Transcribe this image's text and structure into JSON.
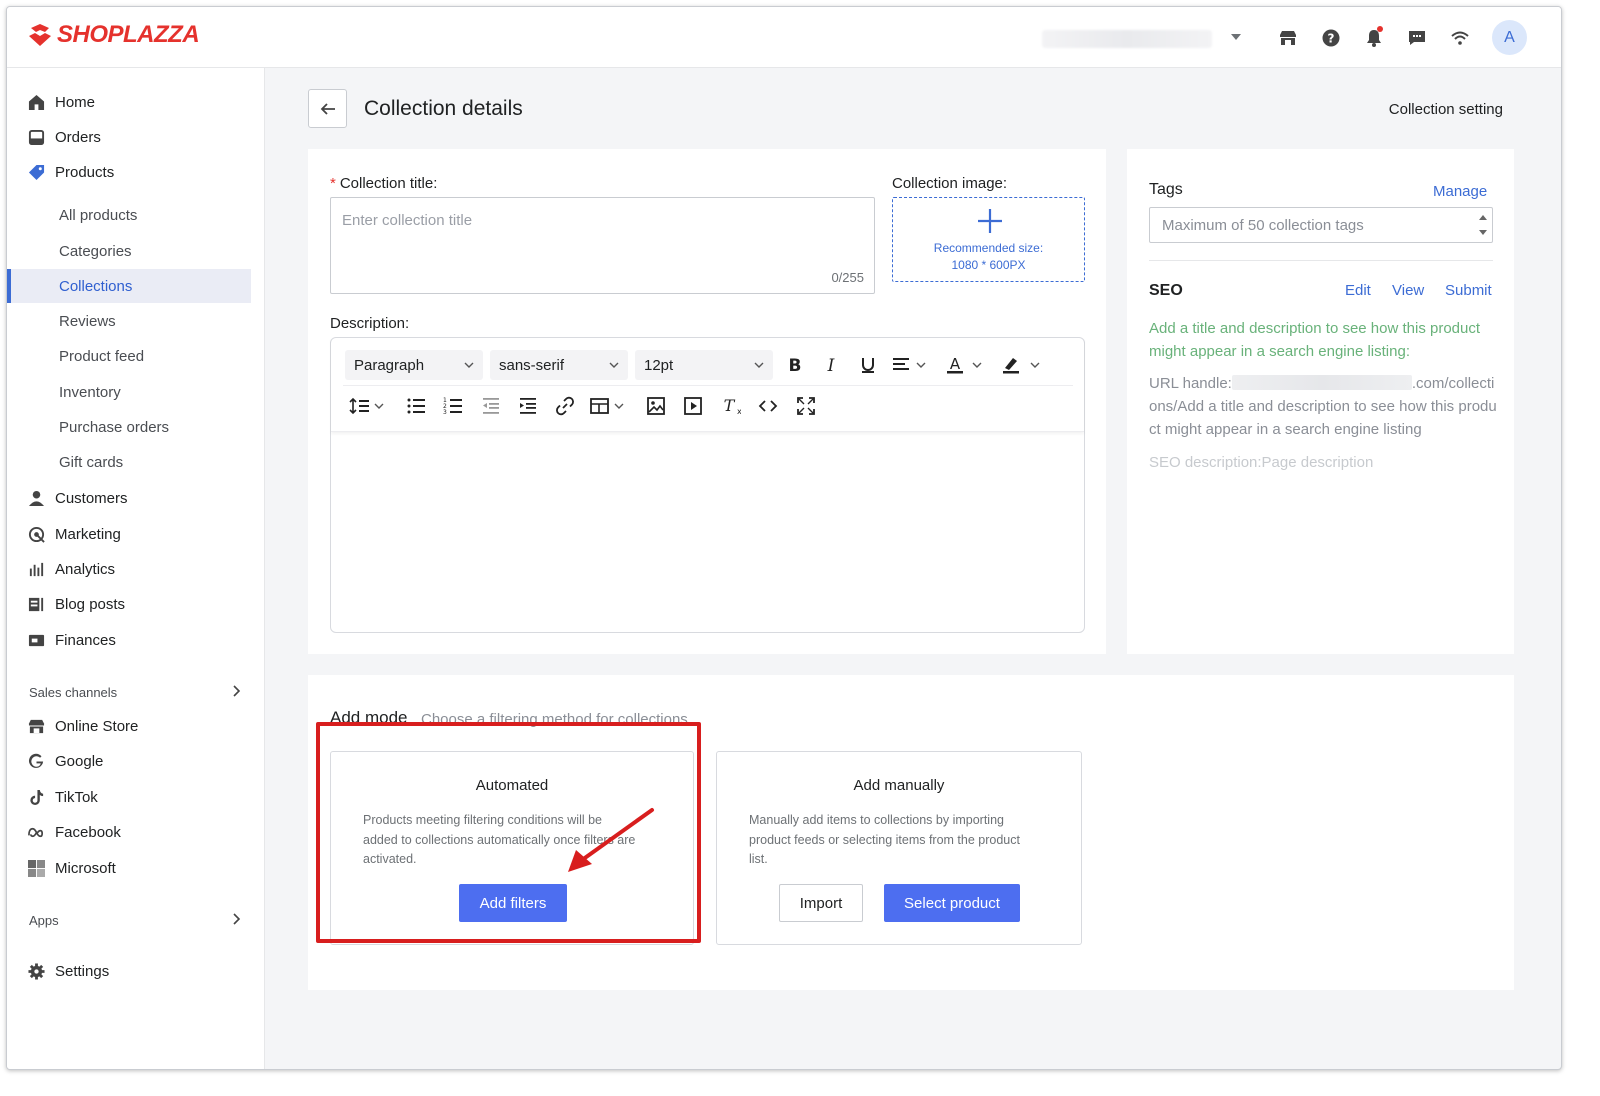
{
  "brand": {
    "logo_text": "SHOPLAZZA",
    "logo_color": "#e5322d",
    "accent": "#3c6cd4"
  },
  "header": {
    "icons": [
      "store-icon",
      "help-icon",
      "bell-icon",
      "message-icon",
      "wifi-icon"
    ],
    "avatar_initial": "A"
  },
  "sidebar": {
    "items": [
      {
        "label": "Home",
        "icon": "home-icon"
      },
      {
        "label": "Orders",
        "icon": "orders-icon"
      },
      {
        "label": "Products",
        "icon": "tag-icon"
      }
    ],
    "products_sub": [
      "All products",
      "Categories",
      "Collections",
      "Reviews",
      "Product feed",
      "Inventory",
      "Purchase orders",
      "Gift cards"
    ],
    "active_sub": "Collections",
    "items2": [
      {
        "label": "Customers",
        "icon": "person-icon"
      },
      {
        "label": "Marketing",
        "icon": "marketing-icon"
      },
      {
        "label": "Analytics",
        "icon": "chart-icon"
      },
      {
        "label": "Blog posts",
        "icon": "blog-icon"
      },
      {
        "label": "Finances",
        "icon": "finance-icon"
      }
    ],
    "sales_channels_label": "Sales channels",
    "channels": [
      {
        "label": "Online Store",
        "icon": "store-icon"
      },
      {
        "label": "Google",
        "icon": "google-icon"
      },
      {
        "label": "TikTok",
        "icon": "tiktok-icon"
      },
      {
        "label": "Facebook",
        "icon": "meta-icon"
      },
      {
        "label": "Microsoft",
        "icon": "microsoft-icon"
      }
    ],
    "apps_label": "Apps",
    "settings_label": "Settings"
  },
  "page": {
    "title": "Collection details",
    "setting_link": "Collection setting"
  },
  "collection": {
    "title_label": "Collection title",
    "title_colon": ":",
    "title_placeholder": "Enter collection title",
    "title_counter": "0/255",
    "image_label": "Collection image",
    "image_colon": ":",
    "image_hint_line1": "Recommended size:",
    "image_hint_line2": "1080 * 600PX",
    "description_label": "Description:"
  },
  "editor": {
    "block_format": "Paragraph",
    "font_family": "sans-serif",
    "font_size": "12pt",
    "row1_tools": [
      "bold-icon",
      "italic-icon",
      "underline-icon",
      "align-icon",
      "font-color-icon",
      "highlight-icon"
    ],
    "row2_tools": [
      "line-height-icon",
      "bullet-list-icon",
      "numbered-list-icon",
      "outdent-icon",
      "indent-icon",
      "link-icon",
      "table-icon",
      "image-icon",
      "video-icon",
      "clear-format-icon",
      "code-icon",
      "fullscreen-icon"
    ]
  },
  "tags": {
    "heading": "Tags",
    "manage_link": "Manage",
    "placeholder": "Maximum of 50 collection tags"
  },
  "seo": {
    "heading": "SEO",
    "edit_link": "Edit",
    "view_link": "View",
    "submit_link": "Submit",
    "hint": "Add a title and description to see how this product might appear in a search engine listing:",
    "url_prefix": "URL handle:",
    "url_suffix": ".com/collections/Add a title and description to see how this product might appear in a search engine listing",
    "description_placeholder": "SEO description:Page description"
  },
  "add_mode": {
    "heading": "Add mode",
    "subheading": "Choose a filtering method for collections",
    "automated": {
      "title": "Automated",
      "description": "Products meeting filtering conditions will be added to collections automatically once filters are activated.",
      "button": "Add filters"
    },
    "manual": {
      "title": "Add manually",
      "description": "Manually add items to collections by importing product feeds or selecting items from the product list.",
      "import_button": "Import",
      "select_button": "Select product"
    }
  }
}
